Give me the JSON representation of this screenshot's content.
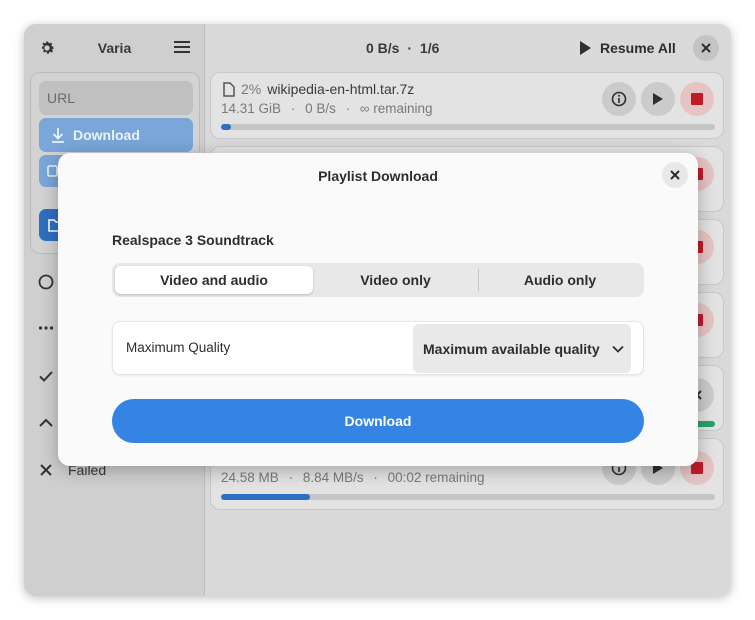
{
  "app": {
    "title": "Varia"
  },
  "header": {
    "speed": "0 B/s",
    "count": "1/6",
    "resume_all_label": "Resume All"
  },
  "sidebar": {
    "url_placeholder": "URL",
    "download_label": "Download",
    "filter_items": [
      {
        "icon": "circle-icon",
        "label": ""
      },
      {
        "icon": "ellipsis-icon",
        "label": ""
      },
      {
        "icon": "checkmark-icon",
        "label": ""
      },
      {
        "icon": "chevron-up-icon",
        "label": ""
      },
      {
        "icon": "close-icon",
        "label": "Failed"
      }
    ]
  },
  "downloads": [
    {
      "percent": "2%",
      "filename": "wikipedia-en-html.tar.7z",
      "size": "14.31 GiB",
      "speed": "0  B/s",
      "remaining": "∞ remaining",
      "progress": 0.02
    },
    {
      "percent": "",
      "filename": "",
      "size": "24.58 MB",
      "speed": "8.84 MB/s",
      "remaining": "00:02 remaining",
      "progress": 0.18
    }
  ],
  "dialog": {
    "title": "Playlist Download",
    "playlist_name": "Realspace 3 Soundtrack",
    "modes": [
      "Video and audio",
      "Video only",
      "Audio only"
    ],
    "selected_mode": "Video and audio",
    "quality_label": "Maximum Quality",
    "quality_value": "Maximum available quality",
    "download_label": "Download"
  },
  "colors": {
    "accent": "#3584e4",
    "stop": "#c01c28",
    "success": "#26a269"
  }
}
